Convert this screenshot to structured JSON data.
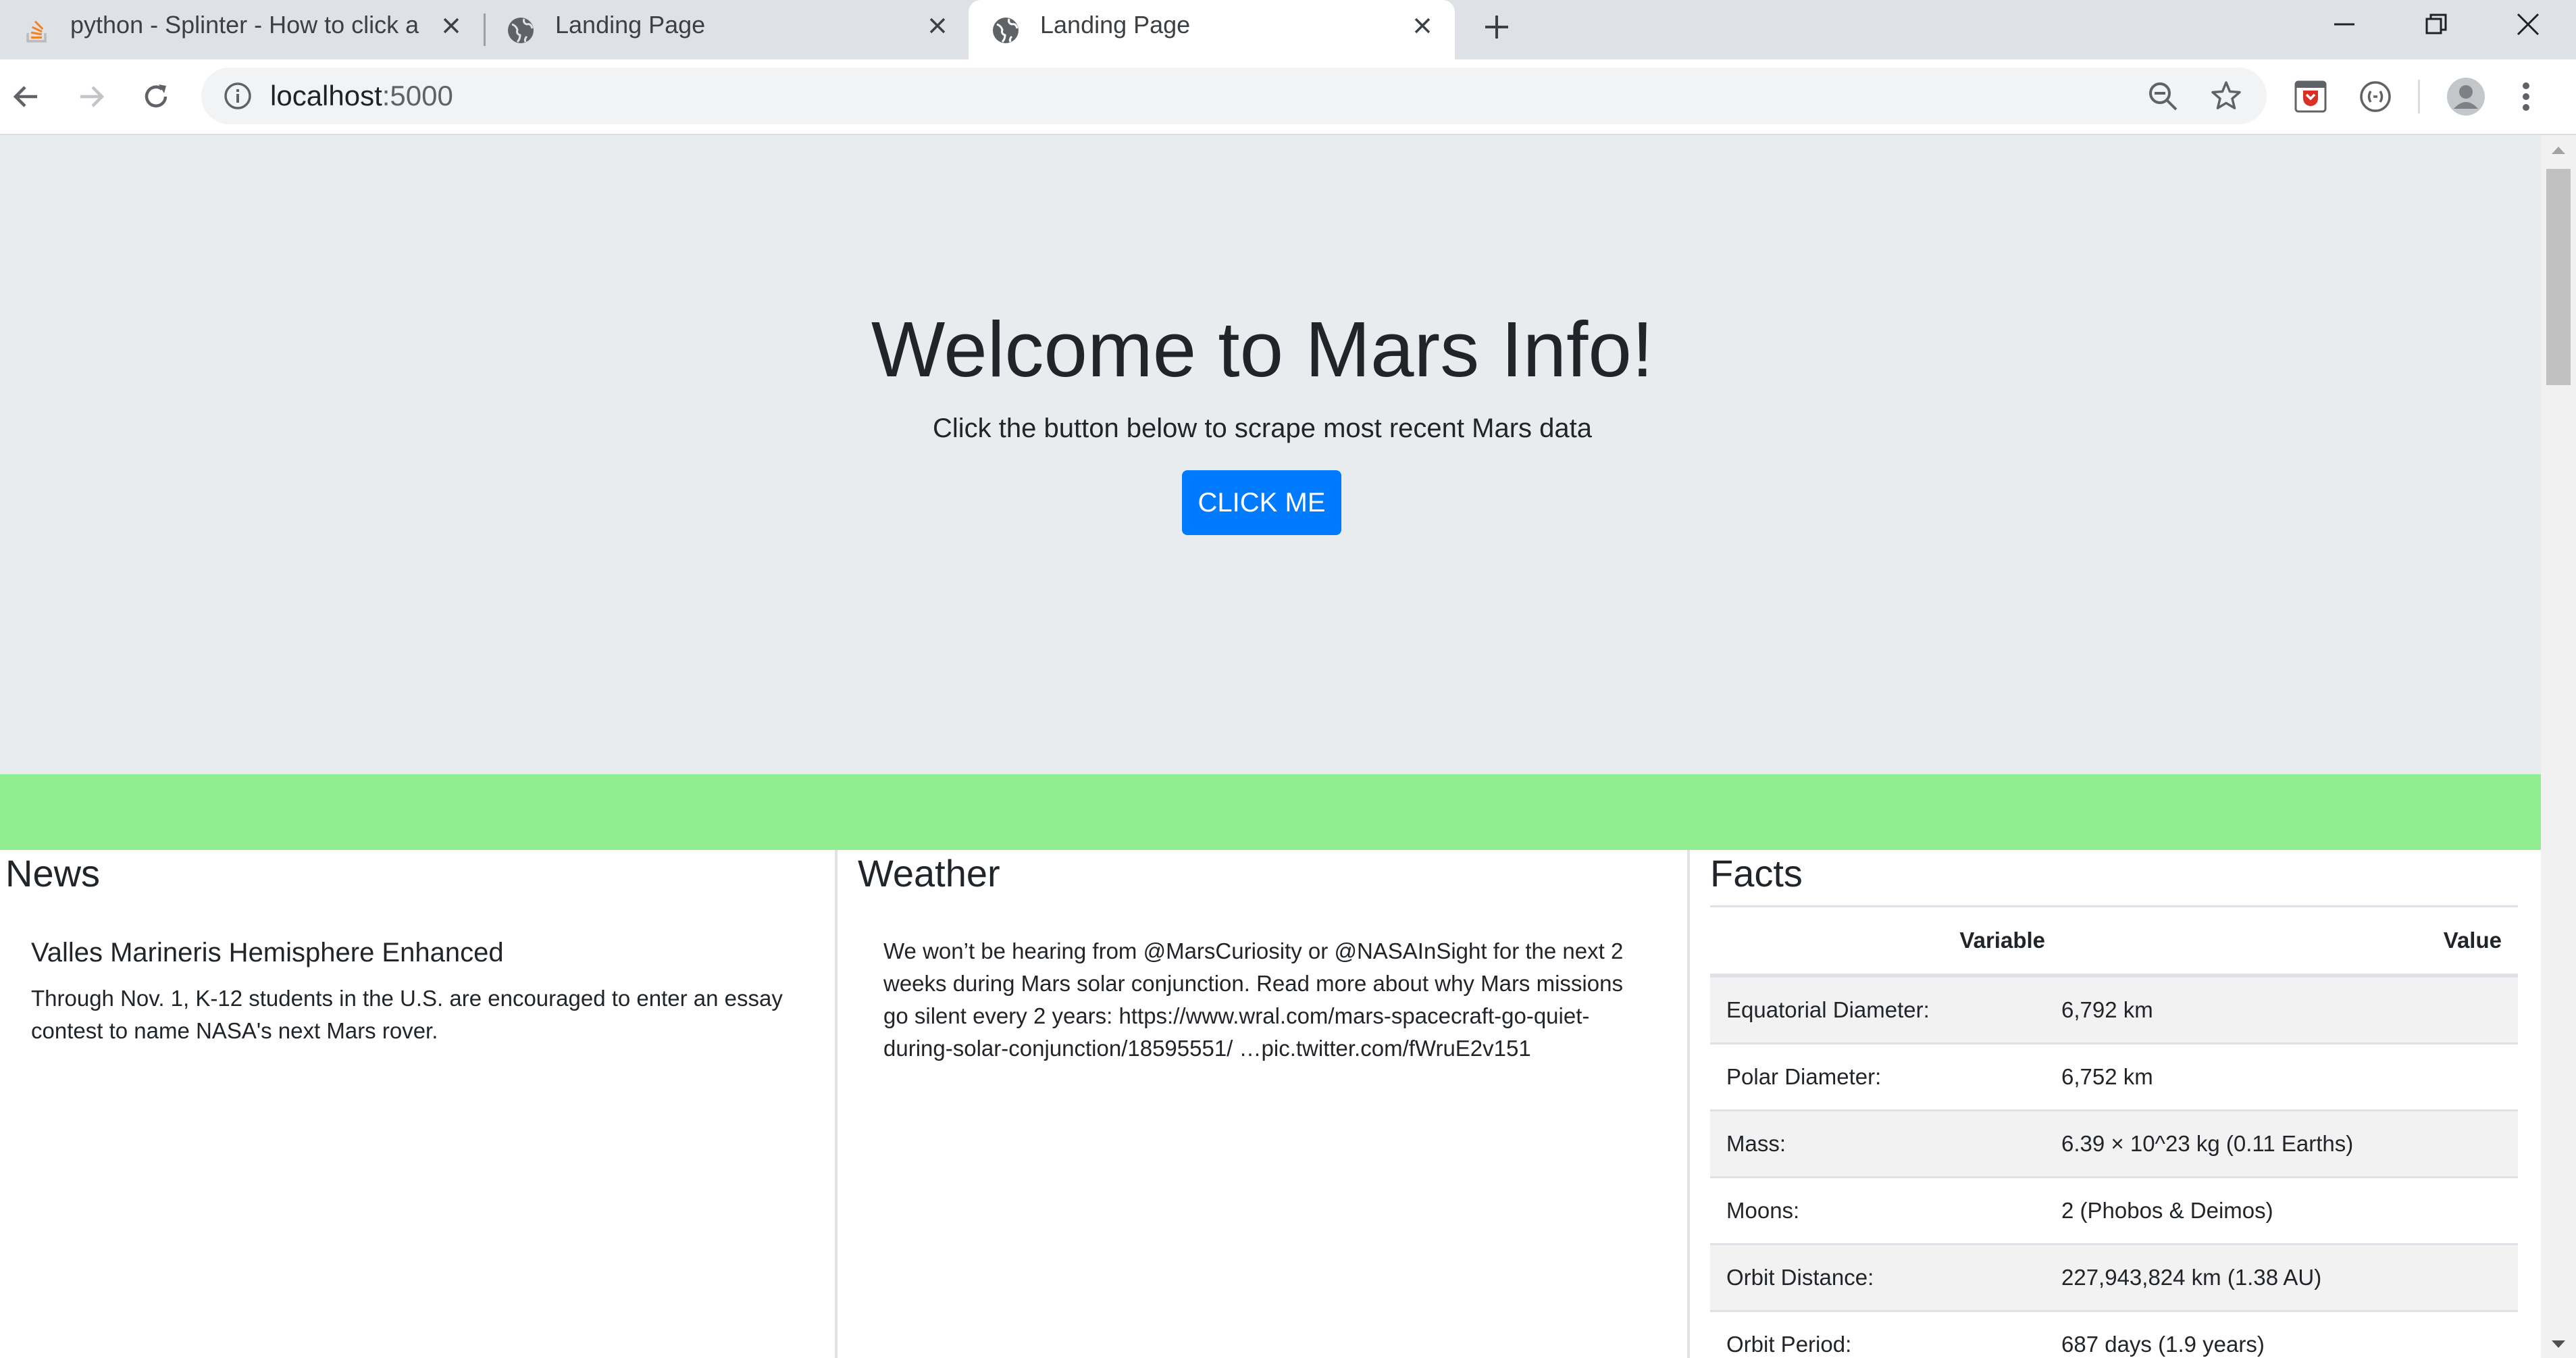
{
  "browser": {
    "tabs": [
      {
        "title": "python - Splinter - How to click a",
        "icon": "stackoverflow-icon",
        "active": false
      },
      {
        "title": "Landing Page",
        "icon": "globe-icon",
        "active": false
      },
      {
        "title": "Landing Page",
        "icon": "globe-icon",
        "active": true
      }
    ],
    "address": {
      "host": "localhost",
      "port": ":5000"
    }
  },
  "hero": {
    "title": "Welcome to Mars Info!",
    "lead": "Click the button below to scrape most recent Mars data",
    "button_label": "CLICK ME"
  },
  "news": {
    "heading": "News",
    "title": "Valles Marineris Hemisphere Enhanced",
    "body": "Through Nov. 1, K-12 students in the U.S. are encouraged to enter an essay contest to name NASA's next Mars rover."
  },
  "weather": {
    "heading": "Weather",
    "body": "We won’t be hearing from @MarsCuriosity or @NASAInSight for the next 2 weeks during Mars solar conjunction. Read more about why Mars missions go silent every 2 years: https://www.wral.com/mars-spacecraft-go-quiet-during-solar-conjunction/18595551/ …pic.twitter.com/fWruE2v151"
  },
  "facts": {
    "heading": "Facts",
    "columns": [
      "Variable",
      "Value"
    ],
    "rows": [
      [
        "Equatorial Diameter:",
        "6,792 km"
      ],
      [
        "Polar Diameter:",
        "6,752 km"
      ],
      [
        "Mass:",
        "6.39 × 10^23 kg (0.11 Earths)"
      ],
      [
        "Moons:",
        "2 (Phobos & Deimos)"
      ],
      [
        "Orbit Distance:",
        "227,943,824 km (1.38 AU)"
      ],
      [
        "Orbit Period:",
        "687 days (1.9 years)"
      ]
    ]
  },
  "colors": {
    "primary_button": "#007bff",
    "jumbotron_bg": "#e9ecef",
    "green_bar": "#90ee90",
    "tab_strip": "#dee1e6"
  }
}
